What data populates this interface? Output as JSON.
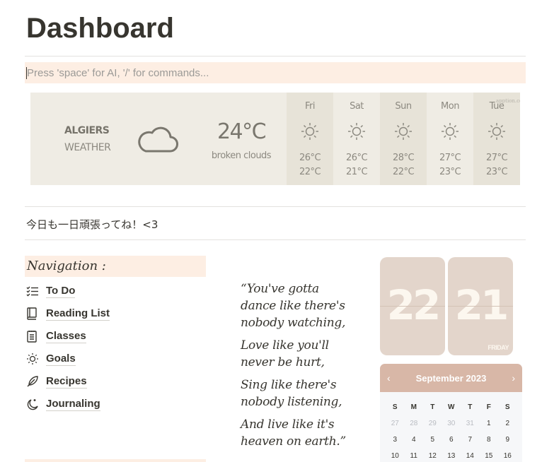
{
  "page": {
    "title": "Dashboard",
    "command_placeholder": "Press 'space' for AI, '/' for commands..."
  },
  "weather": {
    "city": "ALGIERS",
    "subtitle": "WEATHER",
    "icon": "cloud-icon",
    "temp": "24°C",
    "description": "broken clouds",
    "brand": "apption.co",
    "forecast": [
      {
        "day": "Fri",
        "icon": "sun-icon",
        "high": "26°C",
        "low": "22°C"
      },
      {
        "day": "Sat",
        "icon": "sun-icon",
        "high": "26°C",
        "low": "21°C"
      },
      {
        "day": "Sun",
        "icon": "sun-icon",
        "high": "28°C",
        "low": "22°C"
      },
      {
        "day": "Mon",
        "icon": "sun-icon",
        "high": "27°C",
        "low": "23°C"
      },
      {
        "day": "Tue",
        "icon": "sun-icon",
        "high": "27°C",
        "low": "23°C"
      }
    ]
  },
  "motto": "今日も一日頑張ってね！<3",
  "navigation": {
    "heading": "Navigation :",
    "items": [
      {
        "label": "To Do",
        "icon": "checklist-icon"
      },
      {
        "label": "Reading List",
        "icon": "book-icon"
      },
      {
        "label": "Classes",
        "icon": "notepad-icon"
      },
      {
        "label": "Goals",
        "icon": "sun-icon"
      },
      {
        "label": "Recipes",
        "icon": "feather-icon"
      },
      {
        "label": "Journaling",
        "icon": "moon-stars-icon"
      }
    ]
  },
  "quote": {
    "lines": [
      "“You've gotta dance like there's nobody watching,",
      "Love like you'll never be hurt,",
      "Sing like there's nobody listening,",
      "And live like it's heaven on earth.”"
    ]
  },
  "clock": {
    "hours": "22",
    "minutes": "21",
    "weekday": "FRIDAY"
  },
  "calendar": {
    "month": "September 2023",
    "prev": "‹",
    "next": "›",
    "weekdays": [
      "S",
      "M",
      "T",
      "W",
      "T",
      "F",
      "S"
    ],
    "weeks": [
      [
        "27",
        "28",
        "29",
        "30",
        "31",
        "1",
        "2"
      ],
      [
        "3",
        "4",
        "5",
        "6",
        "7",
        "8",
        "9"
      ],
      [
        "10",
        "11",
        "12",
        "13",
        "14",
        "15",
        "16"
      ]
    ],
    "muted_first_row_count": 5
  },
  "colors": {
    "accent_bg": "#fdeee3",
    "weather_bg": "#efece4",
    "clock_bg": "#e3d5cb",
    "calendar_header": "#d8b7a7"
  }
}
